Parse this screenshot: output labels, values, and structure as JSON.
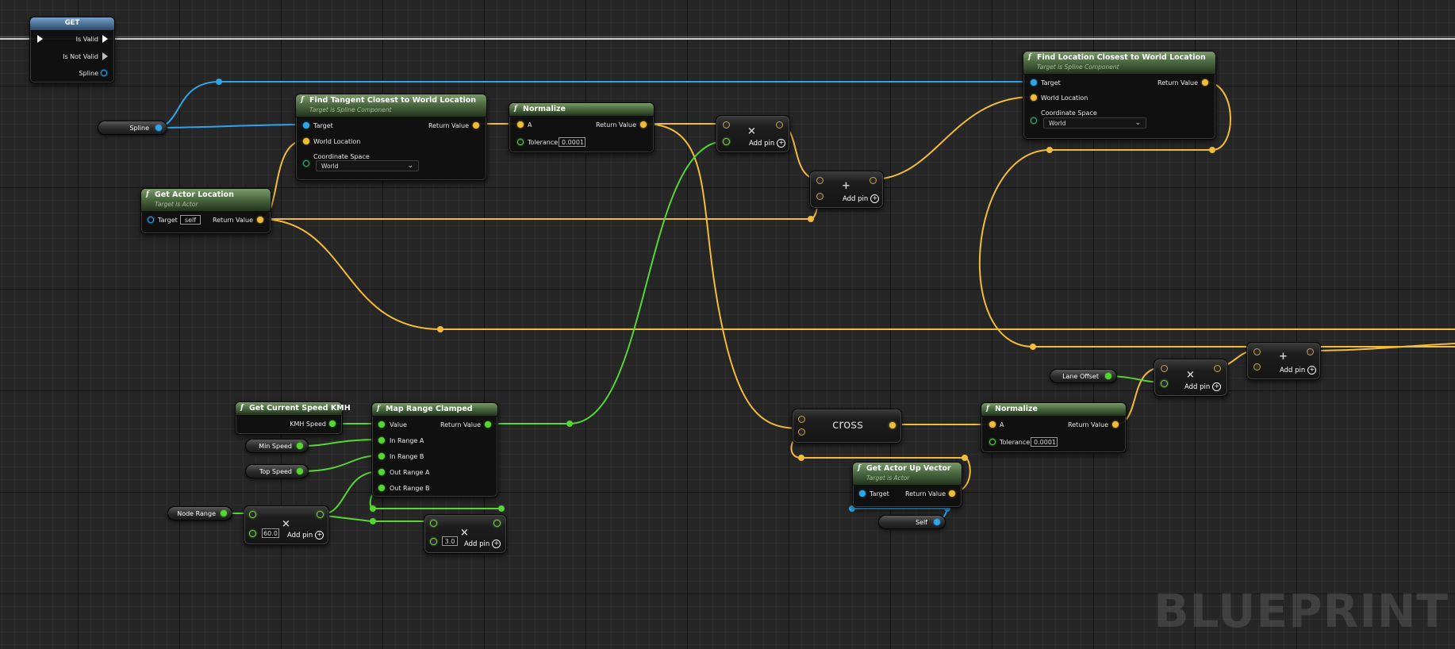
{
  "editor": {
    "watermark": "BLUEPRINT"
  },
  "colors": {
    "vector_pin": "#f2bc3a",
    "float_pin": "#55d633",
    "object_pin": "#2ea5e8",
    "exec_pin": "#ffffff",
    "function_header": "#4d6b42",
    "grid_bg": "#262626"
  },
  "icons": {
    "function": "f-function-icon",
    "add_pin": "plus-circle-icon",
    "dropdown": "chevron-down-icon",
    "multiply": "times-icon",
    "add": "plus-icon"
  },
  "nodes": {
    "get": {
      "title": "GET",
      "is_valid": "Is Valid",
      "is_not_valid": "Is Not Valid",
      "spline": "Spline"
    },
    "spline_var": {
      "label": "Spline"
    },
    "find_tangent": {
      "fx": "f",
      "title": "Find Tangent Closest to World Location",
      "subtitle": "Target is Spline Component",
      "target": "Target",
      "world_location": "World Location",
      "coordinate_space": "Coordinate Space",
      "coordinate_value": "World",
      "return_value": "Return Value"
    },
    "normalize1": {
      "fx": "f",
      "title": "Normalize",
      "a": "A",
      "tolerance": "Tolerance",
      "tolerance_value": "0.0001",
      "return_value": "Return Value"
    },
    "mult1": {
      "sym": "×",
      "add_pin": "Add pin"
    },
    "add1": {
      "sym": "+",
      "add_pin": "Add pin"
    },
    "find_location": {
      "fx": "f",
      "title": "Find Location Closest to World Location",
      "subtitle": "Target is Spline Component",
      "target": "Target",
      "world_location": "World Location",
      "coordinate_space": "Coordinate Space",
      "coordinate_value": "World",
      "return_value": "Return Value"
    },
    "get_actor_location": {
      "fx": "f",
      "title": "Get Actor Location",
      "subtitle": "Target is Actor",
      "target": "Target",
      "target_value": "self",
      "return_value": "Return Value"
    },
    "get_speed": {
      "fx": "f",
      "title": "Get Current Speed KMH",
      "kmh_speed": "KMH Speed"
    },
    "min_speed": {
      "label": "Min Speed"
    },
    "top_speed": {
      "label": "Top Speed"
    },
    "node_range": {
      "label": "Node Range"
    },
    "mult_node_range": {
      "sym": "×",
      "value": "60.0",
      "add_pin": "Add pin"
    },
    "map_range": {
      "fx": "f",
      "title": "Map Range Clamped",
      "value": "Value",
      "in_a": "In Range A",
      "in_b": "In Range B",
      "out_a": "Out Range A",
      "out_b": "Out Range B",
      "return_value": "Return Value"
    },
    "mult_three": {
      "sym": "×",
      "value": "3.0",
      "add_pin": "Add pin"
    },
    "cross": {
      "label": "cross"
    },
    "normalize2": {
      "fx": "f",
      "title": "Normalize",
      "a": "A",
      "tolerance": "Tolerance",
      "tolerance_value": "0.0001",
      "return_value": "Return Value"
    },
    "up_vector": {
      "fx": "f",
      "title": "Get Actor Up Vector",
      "subtitle": "Target is Actor",
      "target": "Target",
      "return_value": "Return Value"
    },
    "self_var": {
      "label": "Self"
    },
    "lane_offset": {
      "label": "Lane Offset"
    },
    "mult_lane": {
      "sym": "×",
      "add_pin": "Add pin"
    },
    "add2": {
      "sym": "+",
      "add_pin": "Add pin"
    }
  }
}
